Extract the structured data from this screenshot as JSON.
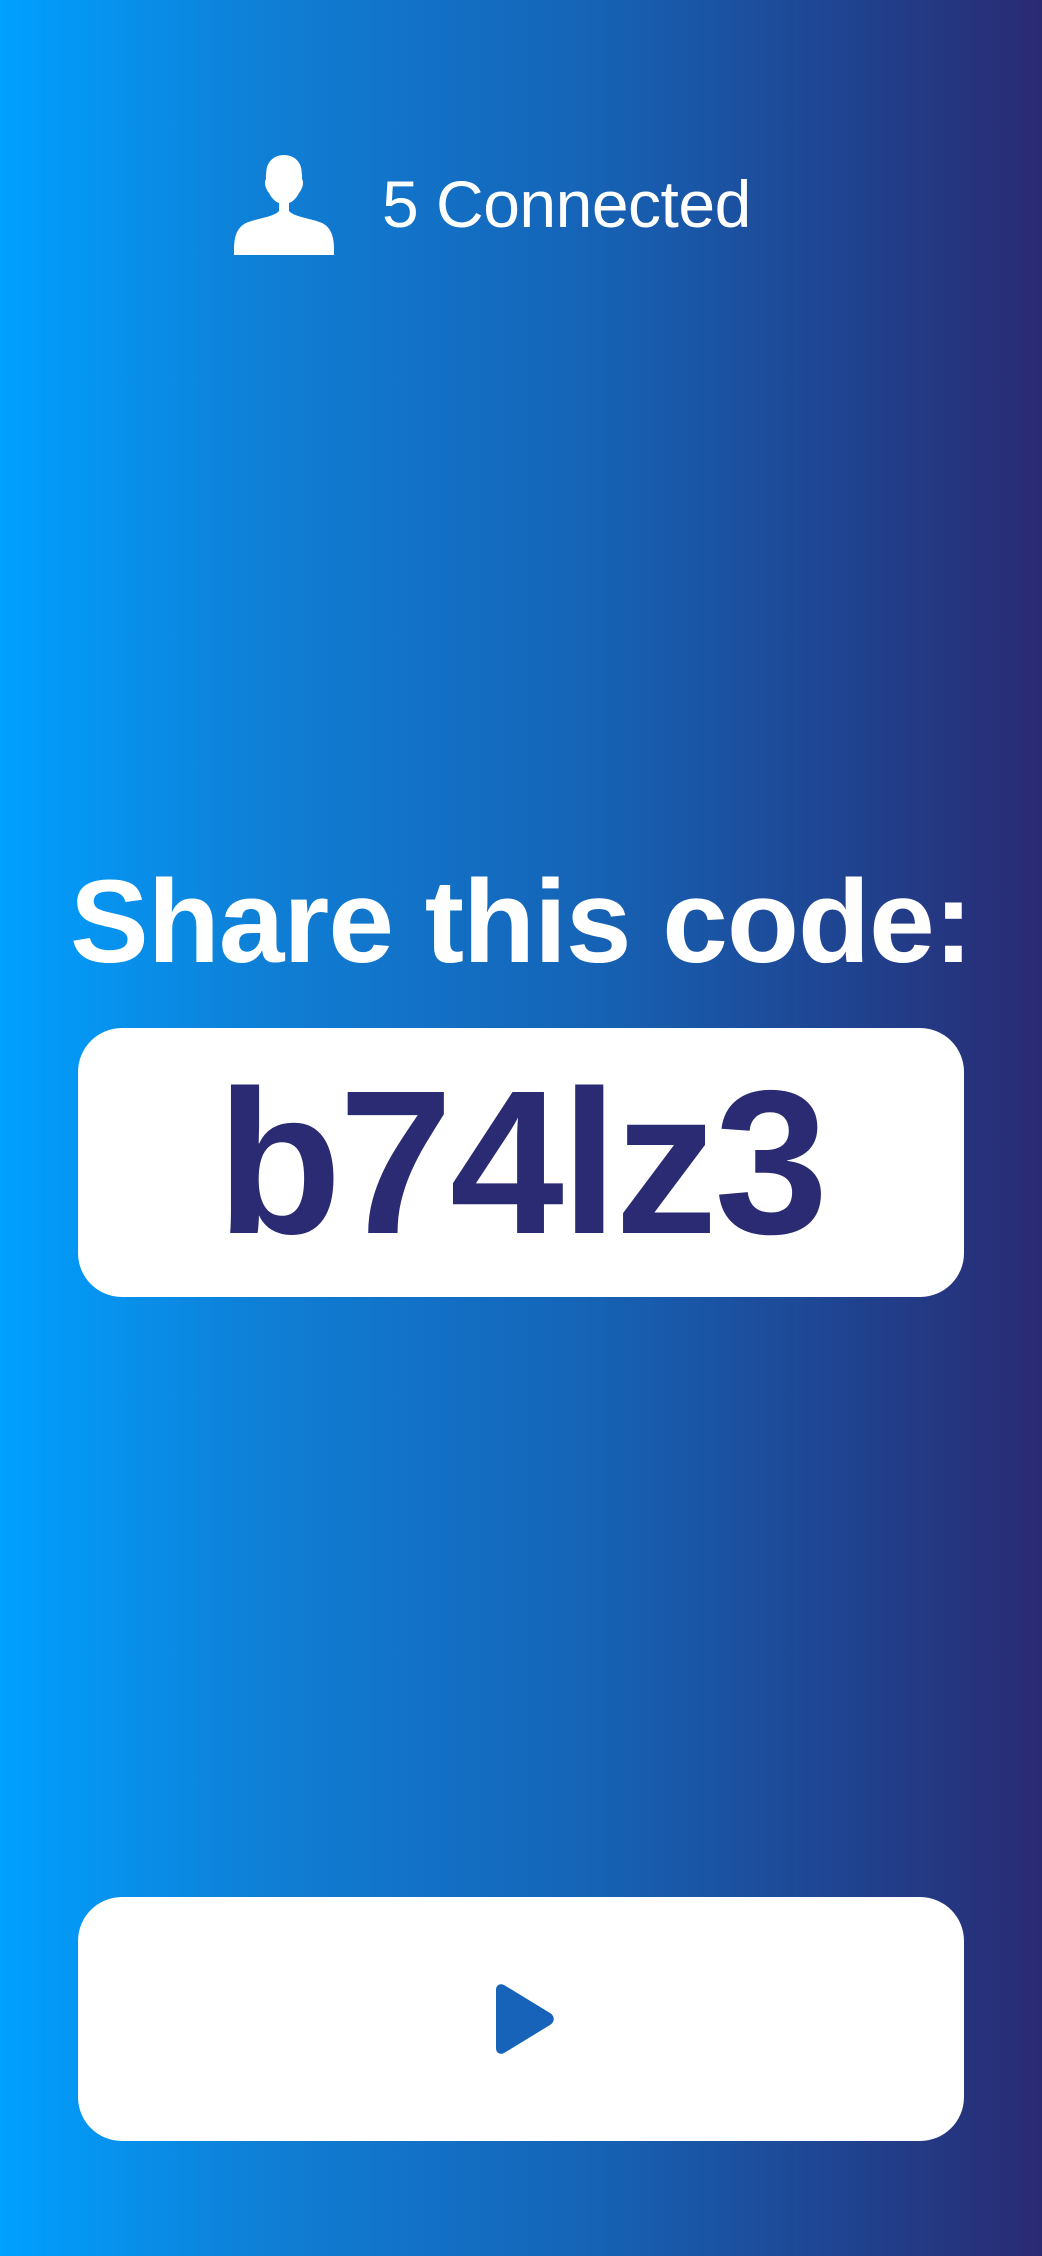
{
  "status": {
    "icon": "user-icon",
    "connected_label": "5 Connected"
  },
  "share": {
    "title": "Share this code:",
    "code": "b74lz3"
  },
  "actions": {
    "start_icon": "play-icon"
  },
  "colors": {
    "gradient_start": "#00a0ff",
    "gradient_end": "#2a2a72",
    "code_text": "#2b2b73",
    "play_icon": "#1763b9",
    "card_background": "#ffffff"
  }
}
